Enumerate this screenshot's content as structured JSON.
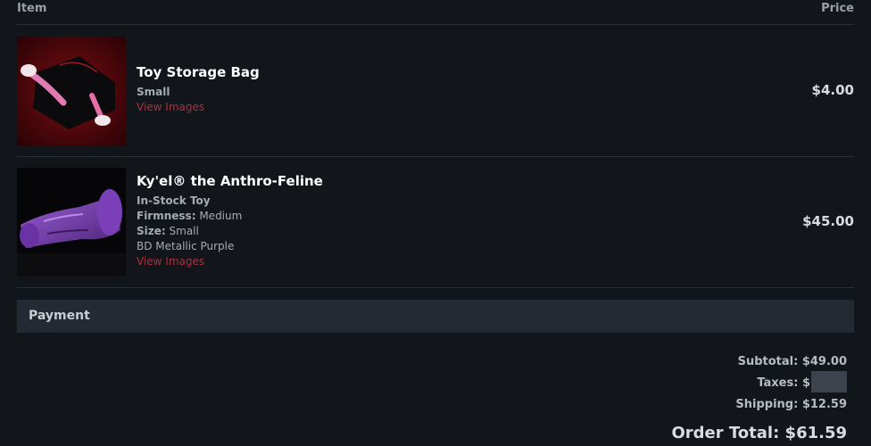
{
  "table": {
    "col_item": "Item",
    "col_price": "Price"
  },
  "items": [
    {
      "title": "Toy Storage Bag",
      "variant": "Small",
      "link": "View Images",
      "price": "$4.00",
      "image": "storage-bag-photo"
    },
    {
      "title": "Ky'el® the Anthro-Feline",
      "variant": "In-Stock Toy",
      "firmness_label": "Firmness:",
      "firmness_value": "Medium",
      "size_label": "Size:",
      "size_value": "Small",
      "color": "BD Metallic Purple",
      "link": "View Images",
      "price": "$45.00",
      "image": "purple-toy-photo"
    }
  ],
  "payment": {
    "heading": "Payment",
    "subtotal": "Subtotal: $49.00",
    "taxes": "Taxes: $",
    "shipping": "Shipping: $12.59",
    "order_total": "Order Total: $61.59"
  },
  "colors": {
    "background": "#12161b",
    "link": "#a6323d",
    "payment_bar": "#242a33"
  }
}
